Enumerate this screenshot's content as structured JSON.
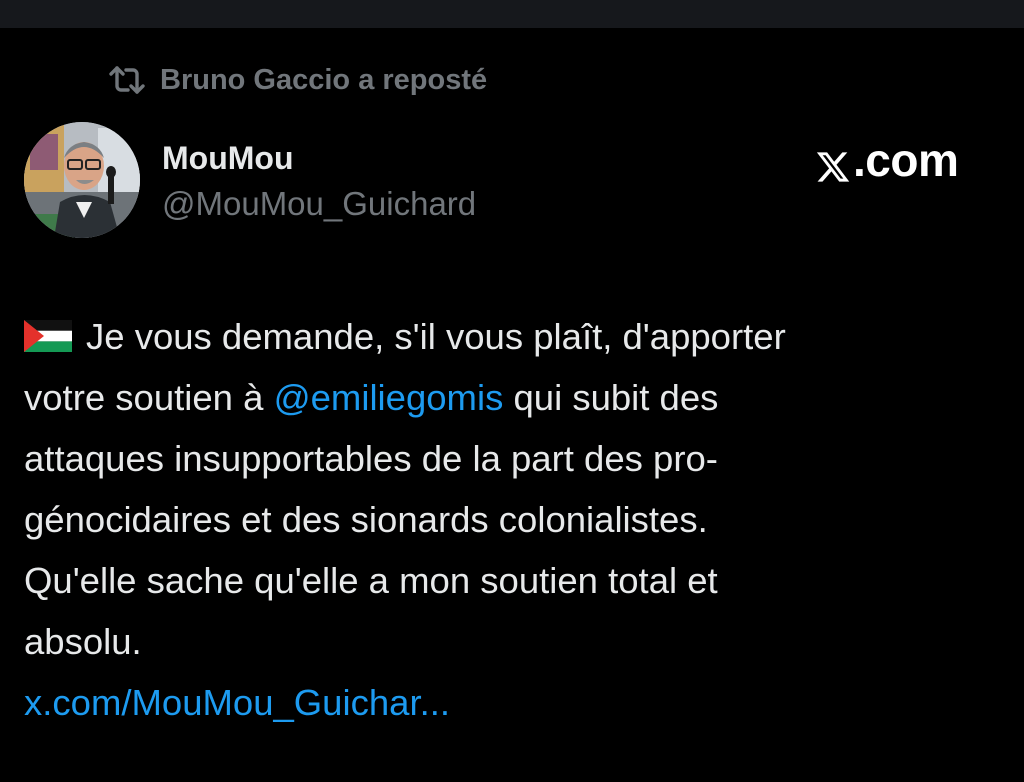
{
  "repost": {
    "label": "Bruno Gaccio a reposté",
    "icon": "repost-icon"
  },
  "author": {
    "name": "MouMou",
    "handle": "@MouMou_Guichard",
    "avatar": "avatar"
  },
  "brand": {
    "x_mark": "x-logo",
    "suffix": ".com"
  },
  "post": {
    "flag": "palestine-flag-icon",
    "line1": "Je vous demande, s'il vous plaît, d'apporter",
    "line2_before": "votre soutien à ",
    "mention": "@emiliegomis",
    "line2_after": " qui subit des",
    "line3": "attaques insupportables de la part des pro-",
    "line4": "génocidaires et des sionards colonialistes.",
    "line5": "Qu'elle sache qu'elle a mon soutien total et",
    "line6": "absolu.",
    "link": "x.com/MouMou_Guichar..."
  },
  "colors": {
    "background": "#000000",
    "text": "#e7e9ea",
    "secondary": "#71767b",
    "link": "#1d9bf0",
    "top_bar": "#16181c"
  }
}
